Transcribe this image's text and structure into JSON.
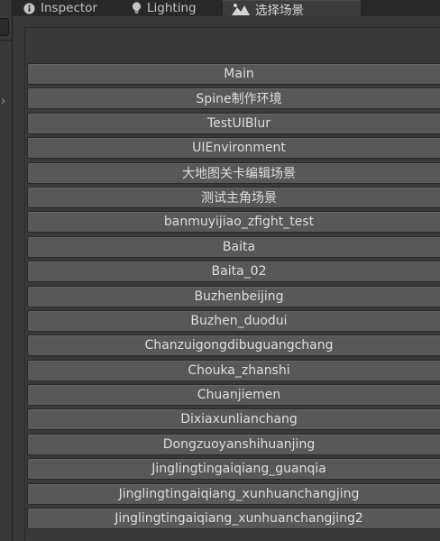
{
  "tabs": {
    "inspector": {
      "label": "Inspector",
      "icon": "info-icon"
    },
    "lighting": {
      "label": "Lighting",
      "icon": "lightbulb-icon"
    },
    "scene_select": {
      "label": "选择场景",
      "icon": "scene-landscape-icon"
    }
  },
  "scenes": [
    "Main",
    "Spine制作环境",
    "TestUIBlur",
    "UIEnvironment",
    "大地图关卡编辑场景",
    "测试主角场景",
    "banmuyijiao_zfight_test",
    "Baita",
    "Baita_02",
    "Buzhenbeijing",
    "Buzhen_duodui",
    "Chanzuigongdibuguangchang",
    "Chouka_zhanshi",
    "Chuanjiemen",
    "Dixiaxunlianchang",
    "Dongzuoyanshihuanjing",
    "Jinglingtingaiqiang_guanqia",
    "Jinglingtingaiqiang_xunhuanchangjing",
    "Jinglingtingaiqiang_xunhuanchangjing2"
  ],
  "colors": {
    "background": "#282828",
    "panel": "#383838",
    "button": "#585858",
    "text": "#dedede"
  }
}
